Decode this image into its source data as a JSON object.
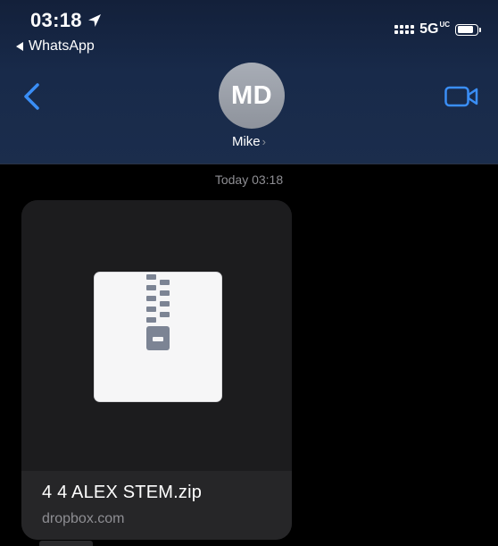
{
  "status_bar": {
    "time": "03:18",
    "back_app_label": "WhatsApp",
    "network": "5G",
    "network_suffix": "UC",
    "location_icon": "location-arrow-icon",
    "signal_icon": "signal-dots-icon",
    "battery_icon": "battery-icon",
    "battery_level": 0.82
  },
  "header": {
    "back_icon": "chevron-left-icon",
    "avatar_initials": "MD",
    "contact_name": "Mike",
    "contact_chevron": "›",
    "video_icon": "video-camera-icon",
    "accent_color": "#3a8ef6"
  },
  "conversation": {
    "timestamp": "Today 03:18",
    "attachment": {
      "file_name": "4 4 ALEX STEM.zip",
      "domain": "dropbox.com",
      "preview_icon": "zip-archive-icon"
    }
  }
}
